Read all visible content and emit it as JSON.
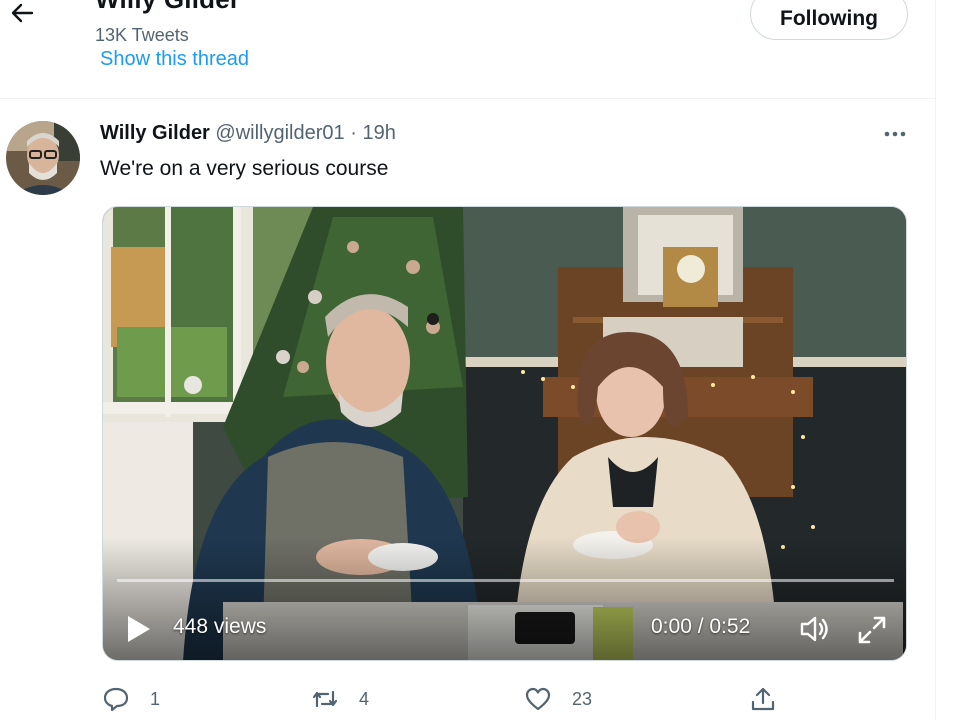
{
  "header": {
    "name": "Willy Gilder",
    "tweet_count": "13K Tweets",
    "show_thread": "Show this thread",
    "following_label": "Following"
  },
  "tweet": {
    "author": "Willy Gilder",
    "handle": "@willygilder01",
    "separator": "·",
    "time": "19h",
    "text": "We're on a very serious course",
    "more_icon": "more-horizontal-icon"
  },
  "video": {
    "views": "448 views",
    "timecode": "0:00 / 0:52",
    "progress": 0,
    "icons": [
      "play-icon",
      "volume-icon",
      "fullscreen-icon"
    ]
  },
  "actions": {
    "reply_count": "1",
    "retweet_count": "4",
    "like_count": "23",
    "icons": [
      "reply-icon",
      "retweet-icon",
      "like-icon",
      "share-icon"
    ]
  },
  "colors": {
    "accent": "#1d9bf0",
    "secondary_text": "#536471",
    "primary_text": "#0f1419",
    "border": "#cfd9de"
  }
}
